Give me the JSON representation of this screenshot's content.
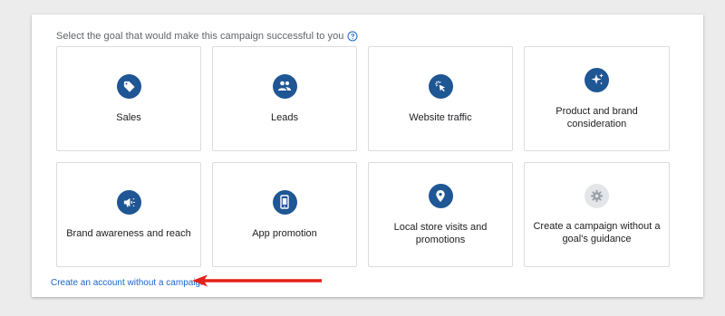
{
  "heading": "Select the goal that would make this campaign successful to you",
  "help_icon": "help-circle-icon",
  "goals": [
    {
      "label": "Sales",
      "icon": "tag-icon"
    },
    {
      "label": "Leads",
      "icon": "people-icon"
    },
    {
      "label": "Website traffic",
      "icon": "cursor-click-icon"
    },
    {
      "label": "Product and brand consideration",
      "icon": "sparkle-icon"
    },
    {
      "label": "Brand awareness and reach",
      "icon": "megaphone-icon"
    },
    {
      "label": "App promotion",
      "icon": "phone-icon"
    },
    {
      "label": "Local store visits and promotions",
      "icon": "location-pin-icon"
    },
    {
      "label": "Create a campaign without a goal's guidance",
      "icon": "gear-icon"
    }
  ],
  "footer_link": "Create an account without a campaign",
  "colors": {
    "icon_bg": "#1f5694",
    "icon_bg_muted": "#e3e5e8",
    "link": "#1a65c9",
    "arrow": "#e32119"
  }
}
